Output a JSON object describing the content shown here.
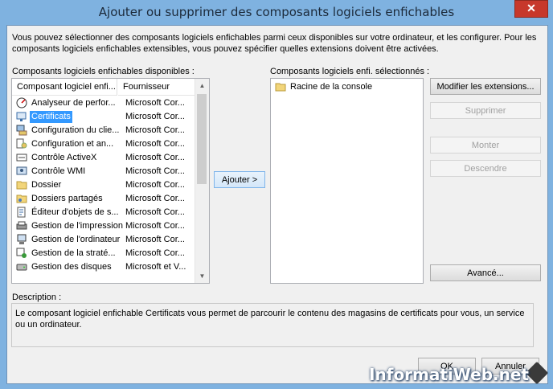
{
  "window": {
    "title": "Ajouter ou supprimer des composants logiciels enfichables",
    "close_glyph": "✕"
  },
  "intro": "Vous pouvez sélectionner des composants logiciels enfichables parmi ceux disponibles sur votre ordinateur, et les configurer. Pour les composants logiciels enfichables extensibles, vous pouvez spécifier quelles extensions doivent être activées.",
  "available": {
    "label": "Composants logiciels enfichables disponibles :",
    "col_component": "Composant logiciel enfi...",
    "col_provider": "Fournisseur",
    "items": [
      {
        "name": "Analyseur de perfor...",
        "provider": "Microsoft Cor...",
        "icon": "performance-analyzer-icon"
      },
      {
        "name": "Certificats",
        "provider": "Microsoft Cor...",
        "icon": "certificates-icon",
        "selected": true
      },
      {
        "name": "Configuration du clie...",
        "provider": "Microsoft Cor...",
        "icon": "client-config-icon"
      },
      {
        "name": "Configuration et an...",
        "provider": "Microsoft Cor...",
        "icon": "config-analysis-icon"
      },
      {
        "name": "Contrôle ActiveX",
        "provider": "Microsoft Cor...",
        "icon": "activex-icon"
      },
      {
        "name": "Contrôle WMI",
        "provider": "Microsoft Cor...",
        "icon": "wmi-icon"
      },
      {
        "name": "Dossier",
        "provider": "Microsoft Cor...",
        "icon": "folder-icon"
      },
      {
        "name": "Dossiers partagés",
        "provider": "Microsoft Cor...",
        "icon": "shared-folders-icon"
      },
      {
        "name": "Éditeur d'objets de s...",
        "provider": "Microsoft Cor...",
        "icon": "object-editor-icon"
      },
      {
        "name": "Gestion de l'impression",
        "provider": "Microsoft Cor...",
        "icon": "print-management-icon"
      },
      {
        "name": "Gestion de l'ordinateur",
        "provider": "Microsoft Cor...",
        "icon": "computer-management-icon"
      },
      {
        "name": "Gestion de la straté...",
        "provider": "Microsoft Cor...",
        "icon": "policy-management-icon"
      },
      {
        "name": "Gestion des disques",
        "provider": "Microsoft et V...",
        "icon": "disk-management-icon"
      }
    ]
  },
  "add_button": "Ajouter >",
  "selected": {
    "label": "Composants logiciels enfi. sélectionnés :",
    "items": [
      {
        "name": "Racine de la console",
        "icon": "console-root-folder-icon"
      }
    ]
  },
  "buttons": {
    "edit_extensions": "Modifier les extensions...",
    "remove": "Supprimer",
    "move_up": "Monter",
    "move_down": "Descendre",
    "advanced": "Avancé...",
    "ok": "OK",
    "cancel": "Annuler"
  },
  "description": {
    "label": "Description :",
    "text": "Le composant logiciel enfichable Certificats vous permet de parcourir le contenu des magasins de certificats pour vous, un service ou un ordinateur."
  },
  "watermark": "InformatiWeb.net"
}
